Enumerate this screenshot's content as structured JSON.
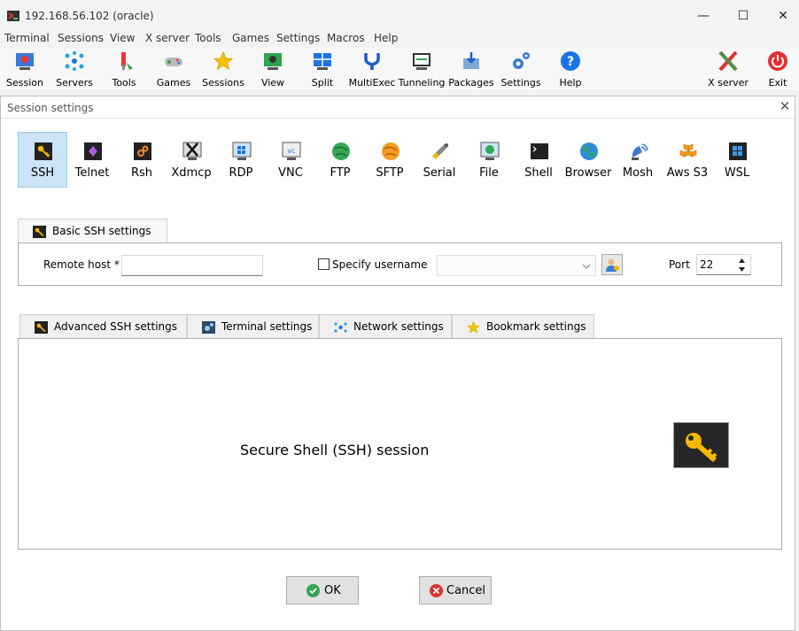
{
  "window": {
    "title": "192.168.56.102 (oracle)",
    "minimize_glyph": "—",
    "maximize_glyph": "☐",
    "close_glyph": "✕"
  },
  "menu": [
    "Terminal",
    "Sessions",
    "View",
    "X server",
    "Tools",
    "Games",
    "Settings",
    "Macros",
    "Help"
  ],
  "toolbar": [
    {
      "label": "Session",
      "icon": "session-icon"
    },
    {
      "label": "Servers",
      "icon": "servers-icon"
    },
    {
      "label": "Tools",
      "icon": "tools-icon"
    },
    {
      "label": "Games",
      "icon": "games-icon"
    },
    {
      "label": "Sessions",
      "icon": "star-icon"
    },
    {
      "label": "View",
      "icon": "view-icon"
    },
    {
      "label": "Split",
      "icon": "split-icon"
    },
    {
      "label": "MultiExec",
      "icon": "multiexec-icon"
    },
    {
      "label": "Tunneling",
      "icon": "tunneling-icon"
    },
    {
      "label": "Packages",
      "icon": "packages-icon"
    },
    {
      "label": "Settings",
      "icon": "settings-icon"
    },
    {
      "label": "Help",
      "icon": "help-icon"
    },
    {
      "label": "X server",
      "icon": "x-server-icon"
    },
    {
      "label": "Exit",
      "icon": "exit-icon"
    }
  ],
  "dialog": {
    "title": "Session settings",
    "close_glyph": "✕",
    "session_types": [
      "SSH",
      "Telnet",
      "Rsh",
      "Xdmcp",
      "RDP",
      "VNC",
      "FTP",
      "SFTP",
      "Serial",
      "File",
      "Shell",
      "Browser",
      "Mosh",
      "Aws S3",
      "WSL"
    ],
    "selected_type": "SSH",
    "basic_tab": "Basic SSH settings",
    "remote_host_label": "Remote host *",
    "remote_host_value": "",
    "specify_username_label": "Specify username",
    "specify_username_checked": false,
    "username_value": "",
    "port_label": "Port",
    "port_value": "22",
    "lower_tabs": [
      "Advanced SSH settings",
      "Terminal settings",
      "Network settings",
      "Bookmark settings"
    ],
    "description": "Secure Shell (SSH) session",
    "ok_label": "OK",
    "cancel_label": "Cancel"
  },
  "colors": {
    "selection_bg": "#cce4f7",
    "accent_blue": "#1a73e8",
    "ok_green": "#2ea44f",
    "cancel_red": "#e03131",
    "key_gold": "#f5b800"
  }
}
